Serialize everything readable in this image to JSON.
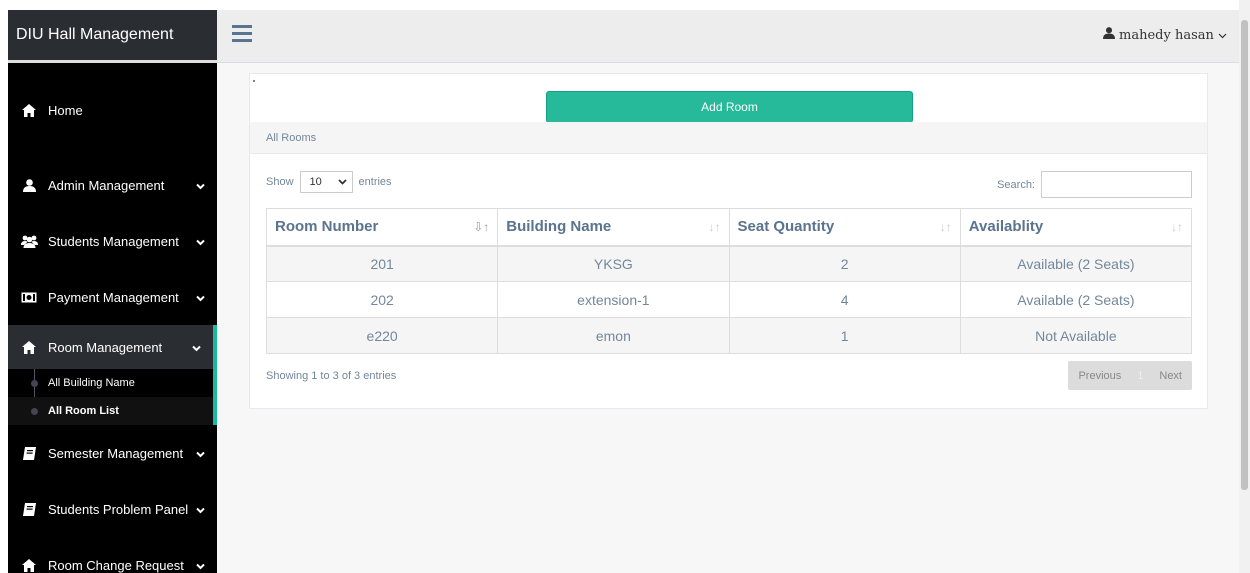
{
  "brand": {
    "title": "DIU Hall Management"
  },
  "topbar": {
    "user_name": "mahedy hasan"
  },
  "sidebar": {
    "items": [
      {
        "label": "Home",
        "icon": "home-icon"
      },
      {
        "label": "Admin Management",
        "icon": "user-icon"
      },
      {
        "label": "Students Management",
        "icon": "users-icon"
      },
      {
        "label": "Payment Management",
        "icon": "money-icon"
      },
      {
        "label": "Room Management",
        "icon": "home-icon"
      },
      {
        "label": "Semester Management",
        "icon": "book-icon"
      },
      {
        "label": "Students Problem Panel",
        "icon": "book-icon"
      },
      {
        "label": "Room Change Request",
        "icon": "home-icon"
      }
    ],
    "room_sub": [
      {
        "label": "All Building Name"
      },
      {
        "label": "All Room List"
      }
    ]
  },
  "panel": {
    "add_button": "Add Room",
    "title": "All Rooms",
    "show_label": "Show",
    "entries_value": "10",
    "entries_label": "entries",
    "search_label": "Search:"
  },
  "table": {
    "headers": [
      "Room Number",
      "Building Name",
      "Seat Quantity",
      "Availablity"
    ],
    "rows": [
      [
        "201",
        "YKSG",
        "2",
        "Available (2 Seats)"
      ],
      [
        "202",
        "extension-1",
        "4",
        "Available (2 Seats)"
      ],
      [
        "e220",
        "emon",
        "1",
        "Not Available"
      ]
    ]
  },
  "footer": {
    "info": "Showing 1 to 3 of 3 entries",
    "prev": "Previous",
    "page": "1",
    "next": "Next"
  },
  "colors": {
    "accent": "#26b99a",
    "sidebar_bg": "#000000",
    "brand_bg": "#2a2e33"
  }
}
